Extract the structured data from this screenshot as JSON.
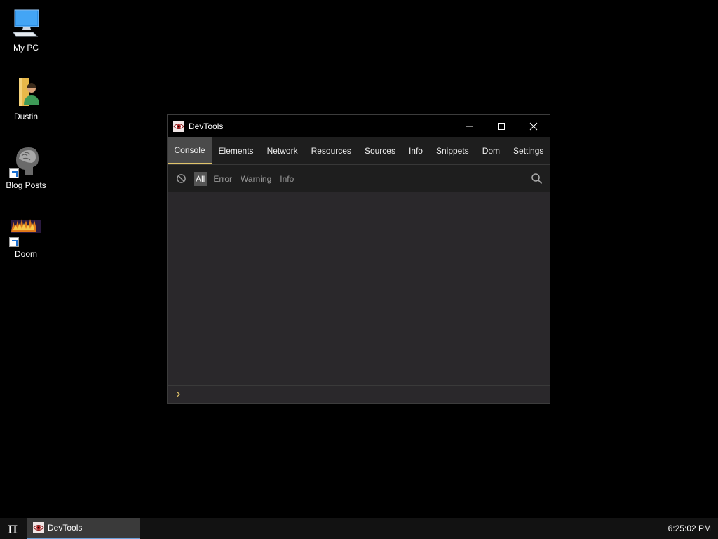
{
  "desktop": {
    "icons": [
      {
        "label": "My PC",
        "icon": "computer-icon"
      },
      {
        "label": "Dustin",
        "icon": "user-folder-icon"
      },
      {
        "label": "Blog Posts",
        "icon": "brain-scan-icon"
      },
      {
        "label": "Doom",
        "icon": "doom-icon"
      }
    ]
  },
  "window": {
    "title": "DevTools",
    "tabs": [
      "Console",
      "Elements",
      "Network",
      "Resources",
      "Sources",
      "Info",
      "Snippets",
      "Dom",
      "Settings"
    ],
    "active_tab": "Console",
    "filters": [
      "All",
      "Error",
      "Warning",
      "Info"
    ],
    "active_filter": "All",
    "prompt_symbol": "›"
  },
  "taskbar": {
    "start_symbol": "π",
    "item_title": "DevTools",
    "clock": "6:25:02 PM"
  },
  "colors": {
    "accent_prompt": "#e0c36a",
    "taskbar_active_underline": "#6aa0d8"
  }
}
